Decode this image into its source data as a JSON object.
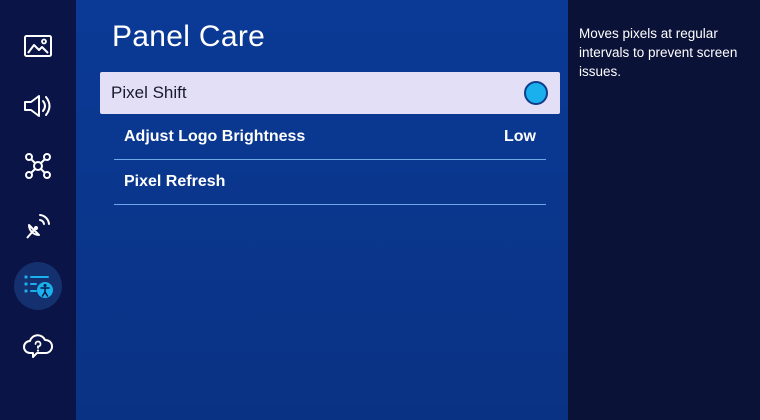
{
  "rail": {
    "items": [
      {
        "icon": "picture-icon"
      },
      {
        "icon": "sound-icon"
      },
      {
        "icon": "connection-icon"
      },
      {
        "icon": "broadcasting-icon"
      },
      {
        "icon": "accessibility-general-icon",
        "selected": true
      },
      {
        "icon": "support-icon"
      }
    ]
  },
  "panel": {
    "title": "Panel Care",
    "items": [
      {
        "label": "Pixel Shift",
        "state": "on"
      },
      {
        "label": "Adjust Logo Brightness",
        "value": "Low"
      },
      {
        "label": "Pixel Refresh"
      }
    ]
  },
  "description": {
    "text": "Moves pixels at regular intervals to prevent screen issues."
  },
  "colors": {
    "panel_bg": "#0a3a96",
    "rail_bg": "#0a1446",
    "desc_bg": "#0a1238",
    "focus_bg": "#e3dff7",
    "toggle_on": "#1ab0ee",
    "divider": "#6fa8e6"
  }
}
